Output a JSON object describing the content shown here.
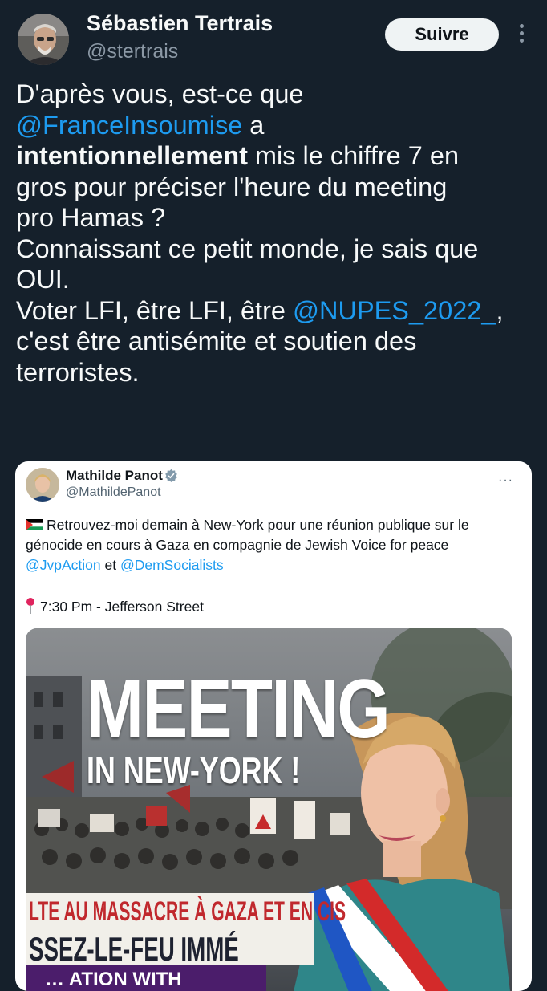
{
  "author": {
    "name": "Sébastien Tertrais",
    "handle": "@stertrais",
    "follow_label": "Suivre"
  },
  "tweet": {
    "t1": "D'après vous, est-ce que\n",
    "m1": "@FranceInsoumise",
    "t2": " a\n",
    "b1": "intentionnellement",
    "t3": " mis le chiffre 7 en\ngros pour préciser l'heure du meeting\npro Hamas ?\nConnaissant ce petit monde, je sais que\nOUI.\nVoter LFI, être LFI, être ",
    "m2": "@NUPES_2022_",
    "t4": ",\nc'est être antisémite et soutien des\nterroristes."
  },
  "quoted": {
    "name": "Mathilde Panot",
    "handle": "@MathildePanot",
    "more": "···",
    "text1": "Retrouvez-moi demain à New-York pour une réunion publique sur le\ngénocide en cours à Gaza en compagnie de Jewish Voice for peace\n",
    "m1": "@JvpAction",
    "t_and": " et ",
    "m2": "@DemSocialists",
    "location": "7:30 Pm - Jefferson Street",
    "poster": {
      "title": "MEETING",
      "subtitle": "IN NEW-YORK !",
      "banner1": "LTE AU MASSACRE À GAZA ET EN CIS",
      "banner2": "SSEZ-LE-FEU IMMÉ",
      "bottom": "… ATION WITH"
    }
  },
  "colors": {
    "background": "#15202b",
    "mention": "#1d9bf0",
    "card": "#ffffff",
    "poster_purple": "#4b1d6b",
    "sash_blue": "#1f56c4",
    "sash_red": "#d32a2a"
  }
}
